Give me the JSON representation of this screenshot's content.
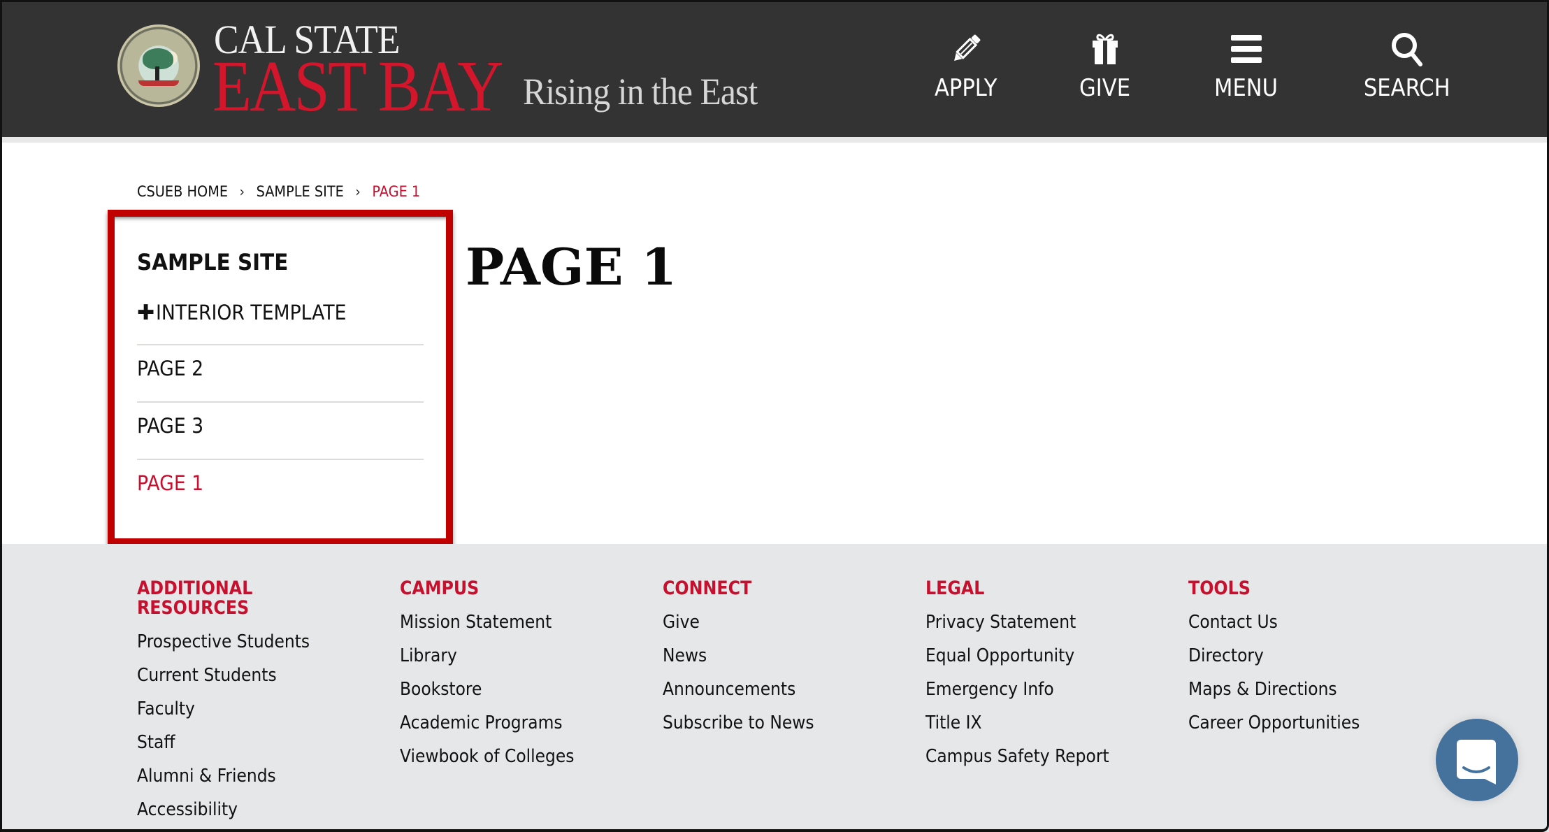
{
  "header": {
    "logo": {
      "line1": "CAL STATE",
      "line2": "EAST BAY",
      "tagline": "Rising in the East",
      "seal_icon": "university-seal-icon"
    },
    "nav": [
      {
        "label": "APPLY",
        "icon": "pencil-icon"
      },
      {
        "label": "GIVE",
        "icon": "gift-icon"
      },
      {
        "label": "MENU",
        "icon": "hamburger-menu-icon"
      },
      {
        "label": "SEARCH",
        "icon": "search-icon"
      }
    ]
  },
  "breadcrumb": {
    "items": [
      "CSUEB HOME",
      "SAMPLE SITE",
      "PAGE 1"
    ],
    "separator": "›"
  },
  "sidebar": {
    "title": "SAMPLE SITE",
    "items": [
      {
        "label": "INTERIOR TEMPLATE",
        "expandable": true,
        "icon": "plus-icon"
      },
      {
        "label": "PAGE 2"
      },
      {
        "label": "PAGE 3"
      },
      {
        "label": "PAGE 1",
        "active": true
      }
    ],
    "plus_glyph": "✚"
  },
  "main": {
    "title": "PAGE 1"
  },
  "footer": {
    "columns": [
      {
        "heading": "ADDITIONAL RESOURCES",
        "links": [
          "Prospective Students",
          "Current Students",
          "Faculty",
          "Staff",
          "Alumni & Friends",
          "Accessibility"
        ]
      },
      {
        "heading": "CAMPUS",
        "links": [
          "Mission Statement",
          "Library",
          "Bookstore",
          "Academic Programs",
          "Viewbook of Colleges"
        ]
      },
      {
        "heading": "CONNECT",
        "links": [
          "Give",
          "News",
          "Announcements",
          "Subscribe to News"
        ]
      },
      {
        "heading": "LEGAL",
        "links": [
          "Privacy Statement",
          "Equal Opportunity",
          "Emergency Info",
          "Title IX",
          "Campus Safety Report"
        ]
      },
      {
        "heading": "TOOLS",
        "links": [
          "Contact Us",
          "Directory",
          "Maps & Directions",
          "Career Opportunities"
        ]
      }
    ]
  },
  "chat_widget": {
    "icon": "chat-bubble-icon"
  },
  "colors": {
    "header_bg": "#333333",
    "brand_red": "#c8102e",
    "highlight_box": "#c00000",
    "footer_bg": "#e6e7e9",
    "chat_blue": "#44729c"
  }
}
